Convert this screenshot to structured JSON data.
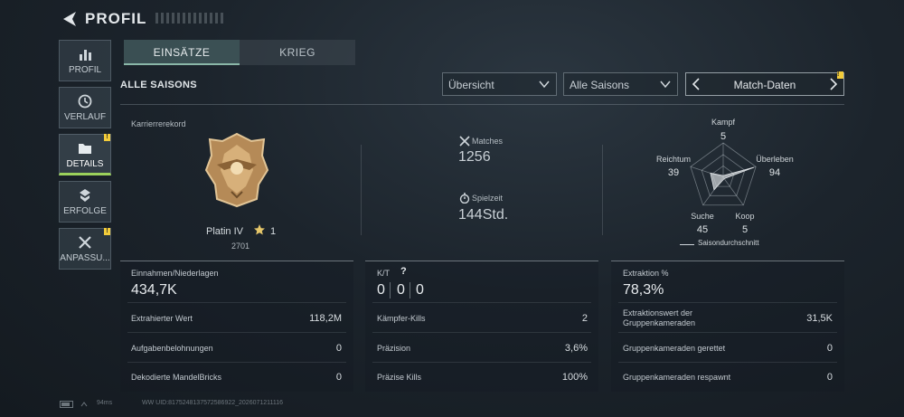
{
  "header": {
    "title": "PROFIL"
  },
  "sidebar": {
    "items": [
      {
        "label": "PROFIL",
        "icon": "bar-chart-icon"
      },
      {
        "label": "VERLAUF",
        "icon": "history-icon"
      },
      {
        "label": "DETAILS",
        "icon": "folder-icon",
        "active": true
      },
      {
        "label": "ERFOLGE",
        "icon": "achievement-icon"
      },
      {
        "label": "ANPASSU...",
        "icon": "tools-icon"
      }
    ]
  },
  "tabs": [
    {
      "label": "EINSÄTZE"
    },
    {
      "label": "KRIEG"
    }
  ],
  "filters": {
    "section_label": "ALLE SAISONS",
    "view": "Übersicht",
    "season": "Alle Saisons",
    "match_data": "Match-Daten"
  },
  "career": {
    "label": "Karrierrerekord",
    "rank": "Platin IV",
    "rank_stars": "1",
    "points": "2701"
  },
  "stats": {
    "matches_label": "Matches",
    "matches_value": "1256",
    "time_label": "Spielzeit",
    "time_value": "144Std."
  },
  "radar": {
    "labels": {
      "kampf": "Kampf",
      "ueberleben": "Überleben",
      "koop": "Koop",
      "suche": "Suche",
      "reichtum": "Reichtum"
    },
    "values": {
      "kampf": "5",
      "ueberleben": "94",
      "koop": "5",
      "suche": "45",
      "reichtum": "39"
    },
    "legend": "Saisondurchschnitt",
    "axis_order": [
      "kampf",
      "ueberleben",
      "koop",
      "suche",
      "reichtum"
    ],
    "axis_scores": [
      5,
      94,
      5,
      45,
      39
    ]
  },
  "panels": {
    "left": {
      "head": "Einnahmen/Niederlagen",
      "big": "434,7K",
      "rows": [
        {
          "label": "Extrahierter Wert",
          "value": "118,2M"
        },
        {
          "label": "Aufgabenbelohnungen",
          "value": "0"
        },
        {
          "label": "Dekodierte MandelBricks",
          "value": "0"
        }
      ]
    },
    "middle": {
      "head": "K/T",
      "help": "?",
      "kt": [
        "0",
        "0",
        "0"
      ],
      "rows": [
        {
          "label": "Kämpfer-Kills",
          "value": "2"
        },
        {
          "label": "Präzision",
          "value": "3,6%"
        },
        {
          "label": "Präzise Kills",
          "value": "100%"
        }
      ]
    },
    "right": {
      "head": "Extraktion %",
      "big": "78,3%",
      "rows": [
        {
          "label": "Extraktionswert der\nGruppenkameraden",
          "value": "31,5K"
        },
        {
          "label": "Gruppenkameraden gerettet",
          "value": "0"
        },
        {
          "label": "Gruppenkameraden respawnt",
          "value": "0"
        }
      ]
    }
  },
  "status": {
    "ping": "94ms",
    "footer_id": "WW UID:8175248137572586922_2026071211116"
  },
  "colors": {
    "accent": "#9bd15b",
    "badge": "#f3cc3a"
  }
}
